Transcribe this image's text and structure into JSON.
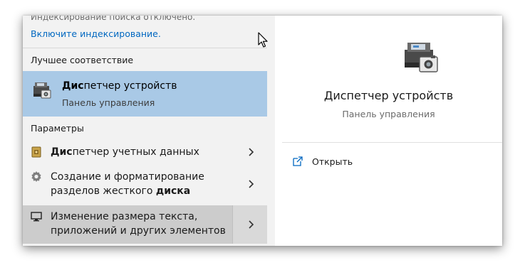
{
  "notice": {
    "partial_text": "Индексирование поиска отключено.",
    "link": "Включите индексирование."
  },
  "best_match": {
    "header": "Лучшее соответствие",
    "title_bold": "Дис",
    "title_rest": "петчер устройств",
    "subtitle": "Панель управления",
    "icon": "device-manager-icon"
  },
  "settings": {
    "header": "Параметры",
    "items": [
      {
        "line1_bold": "Дис",
        "line1_rest": "петчер учетных данных",
        "line2_pre": "",
        "line2_bold": "",
        "icon": "credential-manager-icon"
      },
      {
        "line1_bold": "",
        "line1_rest": "Создание и форматирование",
        "line2_pre": "разделов жесткого ",
        "line2_bold": "диска",
        "icon": "disk-management-icon"
      },
      {
        "line1_bold": "",
        "line1_rest": "Изменение размера текста,",
        "line2_pre": "приложений и других элементов",
        "line2_bold": "",
        "icon": "display-icon"
      }
    ]
  },
  "preview": {
    "title": "Диспетчер устройств",
    "subtitle": "Панель управления",
    "action_open": "Открыть",
    "icon": "device-manager-icon"
  },
  "colors": {
    "selection": "#a9c9e6",
    "hover": "#cccccc",
    "link": "#0067c0"
  }
}
